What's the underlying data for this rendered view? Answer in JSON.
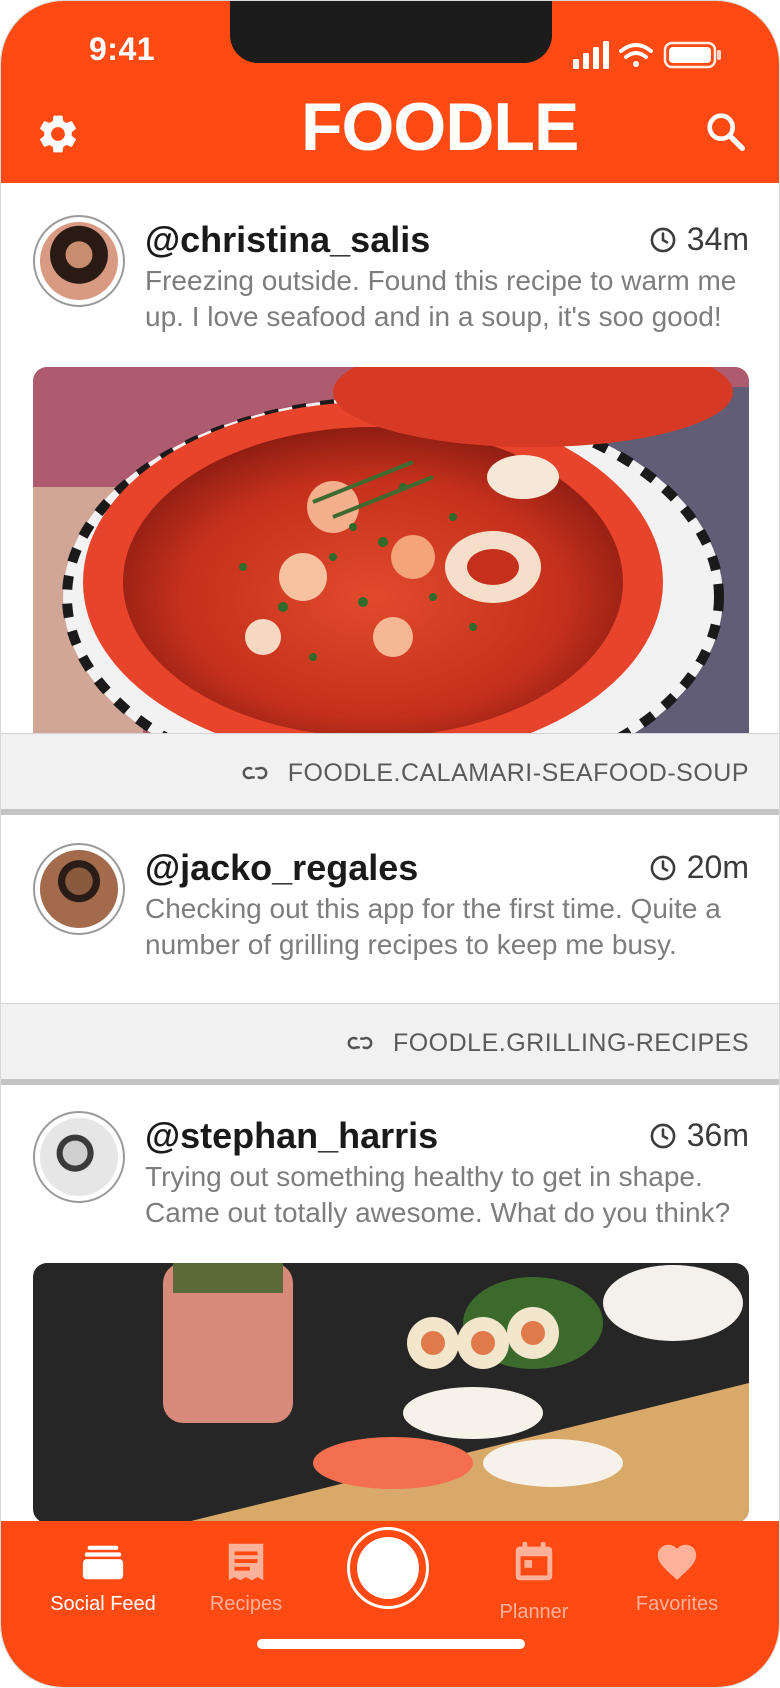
{
  "status_bar": {
    "time": "9:41"
  },
  "header": {
    "logo": "FOODLE",
    "settings_icon": "gear-icon",
    "search_icon": "search-icon"
  },
  "colors": {
    "brand": "#ff4a13",
    "text_dark": "#1a1a1a",
    "text_muted": "#7d7d7d"
  },
  "posts": [
    {
      "username": "@christina_salis",
      "time_ago": "34m",
      "text": "Freezing outside. Found this recipe to warm me up. I love seafood and in a soup, it's soo good!",
      "link": "FOODLE.CALAMARI-SEAFOOD-SOUP"
    },
    {
      "username": "@jacko_regales",
      "time_ago": "20m",
      "text": "Checking out this app for the first time. Quite a number of grilling recipes to keep me busy.",
      "link": "FOODLE.GRILLING-RECIPES"
    },
    {
      "username": "@stephan_harris",
      "time_ago": "36m",
      "text": "Trying out something healthy to get in shape. Came out totally awesome. What do you think?"
    }
  ],
  "tabs": [
    {
      "label": "Social Feed",
      "icon": "feed-icon",
      "active": true
    },
    {
      "label": "Recipes",
      "icon": "recipe-icon",
      "active": false
    },
    {
      "label": "Planner",
      "icon": "calendar-icon",
      "active": false
    },
    {
      "label": "Favorites",
      "icon": "heart-icon",
      "active": false
    }
  ]
}
